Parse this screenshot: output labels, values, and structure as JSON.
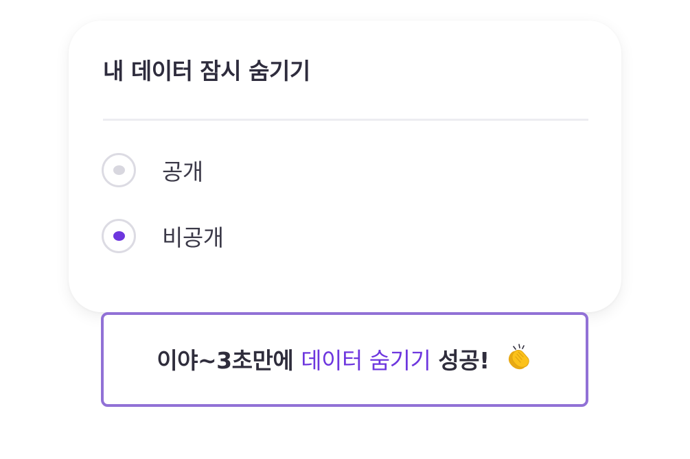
{
  "card": {
    "title": "내 데이터 잠시 숨기기",
    "options": [
      {
        "label": "공개",
        "selected": false
      },
      {
        "label": "비공개",
        "selected": true
      }
    ]
  },
  "toast": {
    "prefix": "이야~3초만에",
    "highlight": "데이터 숨기기",
    "suffix": "성공!",
    "icon": "clapping-hands-icon"
  },
  "colors": {
    "accent": "#6d36de",
    "toast_border": "#9171d6",
    "text": "#2e2c3d",
    "radio_border": "#dcdbe3",
    "radio_dot_inactive": "#d8d7df"
  }
}
